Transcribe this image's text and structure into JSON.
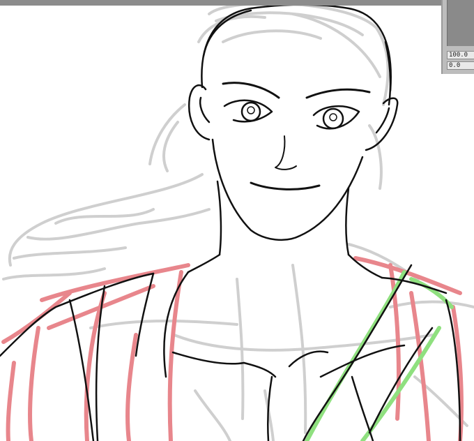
{
  "panel": {
    "opacity_value": "100.0",
    "blur_value": "0.0"
  },
  "layers": {
    "sketch_color": "#c8c8c8",
    "lineart_color": "#111111",
    "red_color": "#e8868c",
    "green_color": "#8fe07f"
  }
}
